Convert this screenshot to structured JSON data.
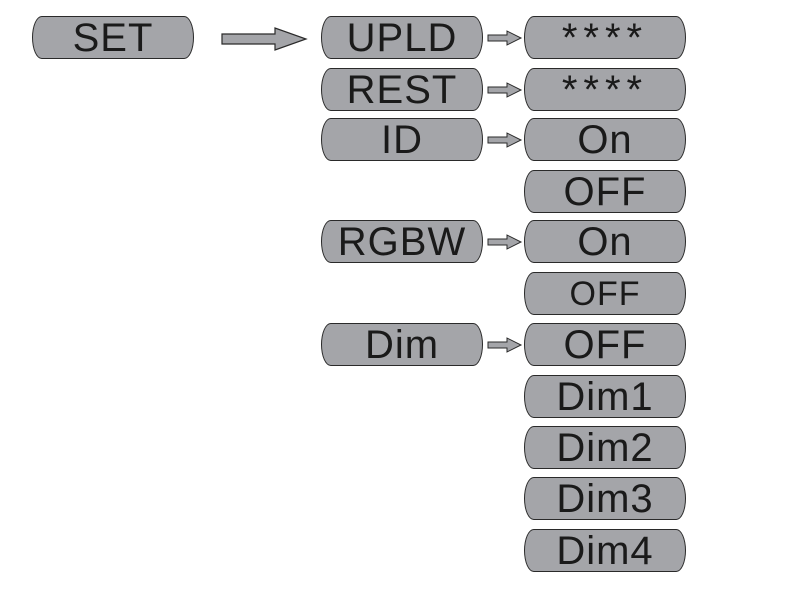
{
  "root": {
    "label": "SET"
  },
  "menu": [
    {
      "label": "UPLD",
      "options": [
        "****"
      ]
    },
    {
      "label": "REST",
      "options": [
        "****"
      ]
    },
    {
      "label": "ID",
      "options": [
        "On",
        "OFF"
      ]
    },
    {
      "label": "RGBW",
      "options": [
        "On",
        "OFF"
      ]
    },
    {
      "label": "Dim",
      "options": [
        "OFF",
        "Dim1",
        "Dim2",
        "Dim3",
        "Dim4"
      ]
    }
  ],
  "colors": {
    "box_fill": "#a4a5a9",
    "outline": "#2a2a2a"
  }
}
